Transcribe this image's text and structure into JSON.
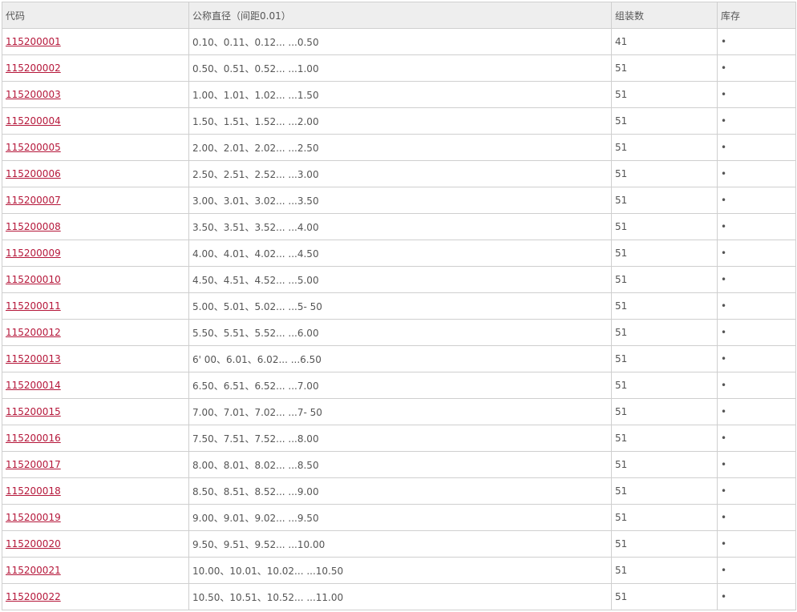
{
  "headers": [
    "代码",
    "公称直径（间距0.01）",
    "组装数",
    "库存"
  ],
  "rows": [
    {
      "code": "115200001",
      "diameter": "0.10、0.11、0.12... ...0.50",
      "count": "41",
      "stock": "•"
    },
    {
      "code": "115200002",
      "diameter": "0.50、0.51、0.52... ...1.00",
      "count": "51",
      "stock": "•"
    },
    {
      "code": "115200003",
      "diameter": "1.00、1.01、1.02... ...1.50",
      "count": "51",
      "stock": "•"
    },
    {
      "code": "115200004",
      "diameter": "1.50、1.51、1.52... ...2.00",
      "count": "51",
      "stock": "•"
    },
    {
      "code": "115200005",
      "diameter": "2.00、2.01、2.02... ...2.50",
      "count": "51",
      "stock": "•"
    },
    {
      "code": "115200006",
      "diameter": "2.50、2.51、2.52... ...3.00",
      "count": "51",
      "stock": "•"
    },
    {
      "code": "115200007",
      "diameter": "3.00、3.01、3.02... ...3.50",
      "count": "51",
      "stock": "•"
    },
    {
      "code": "115200008",
      "diameter": "3.50、3.51、3.52... ...4.00",
      "count": "51",
      "stock": "•"
    },
    {
      "code": "115200009",
      "diameter": "4.00、4.01、4.02... ...4.50",
      "count": "51",
      "stock": "•"
    },
    {
      "code": "115200010",
      "diameter": "4.50、4.51、4.52... ...5.00",
      "count": "51",
      "stock": "•"
    },
    {
      "code": "115200011",
      "diameter": "5.00、5.01、5.02... ...5- 50",
      "count": "51",
      "stock": "•"
    },
    {
      "code": "115200012",
      "diameter": "5.50、5.51、5.52... ...6.00",
      "count": "51",
      "stock": "•"
    },
    {
      "code": "115200013",
      "diameter": "6' 00、6.01、6.02... ...6.50",
      "count": "51",
      "stock": "•"
    },
    {
      "code": "115200014",
      "diameter": "6.50、6.51、6.52... ...7.00",
      "count": "51",
      "stock": "•"
    },
    {
      "code": "115200015",
      "diameter": "7.00、7.01、7.02... ...7- 50",
      "count": "51",
      "stock": "•"
    },
    {
      "code": "115200016",
      "diameter": "7.50、7.51、7.52... ...8.00",
      "count": "51",
      "stock": "•"
    },
    {
      "code": "115200017",
      "diameter": "8.00、8.01、8.02... ...8.50",
      "count": "51",
      "stock": "•"
    },
    {
      "code": "115200018",
      "diameter": "8.50、8.51、8.52... ...9.00",
      "count": "51",
      "stock": "•"
    },
    {
      "code": "115200019",
      "diameter": "9.00、9.01、9.02... ...9.50",
      "count": "51",
      "stock": "•"
    },
    {
      "code": "115200020",
      "diameter": "9.50、9.51、9.52... ...10.00",
      "count": "51",
      "stock": "•"
    },
    {
      "code": "115200021",
      "diameter": "10.00、10.01、10.02... ...10.50",
      "count": "51",
      "stock": "•"
    },
    {
      "code": "115200022",
      "diameter": "10.50、10.51、10.52... ...11.00",
      "count": "51",
      "stock": "•"
    }
  ]
}
